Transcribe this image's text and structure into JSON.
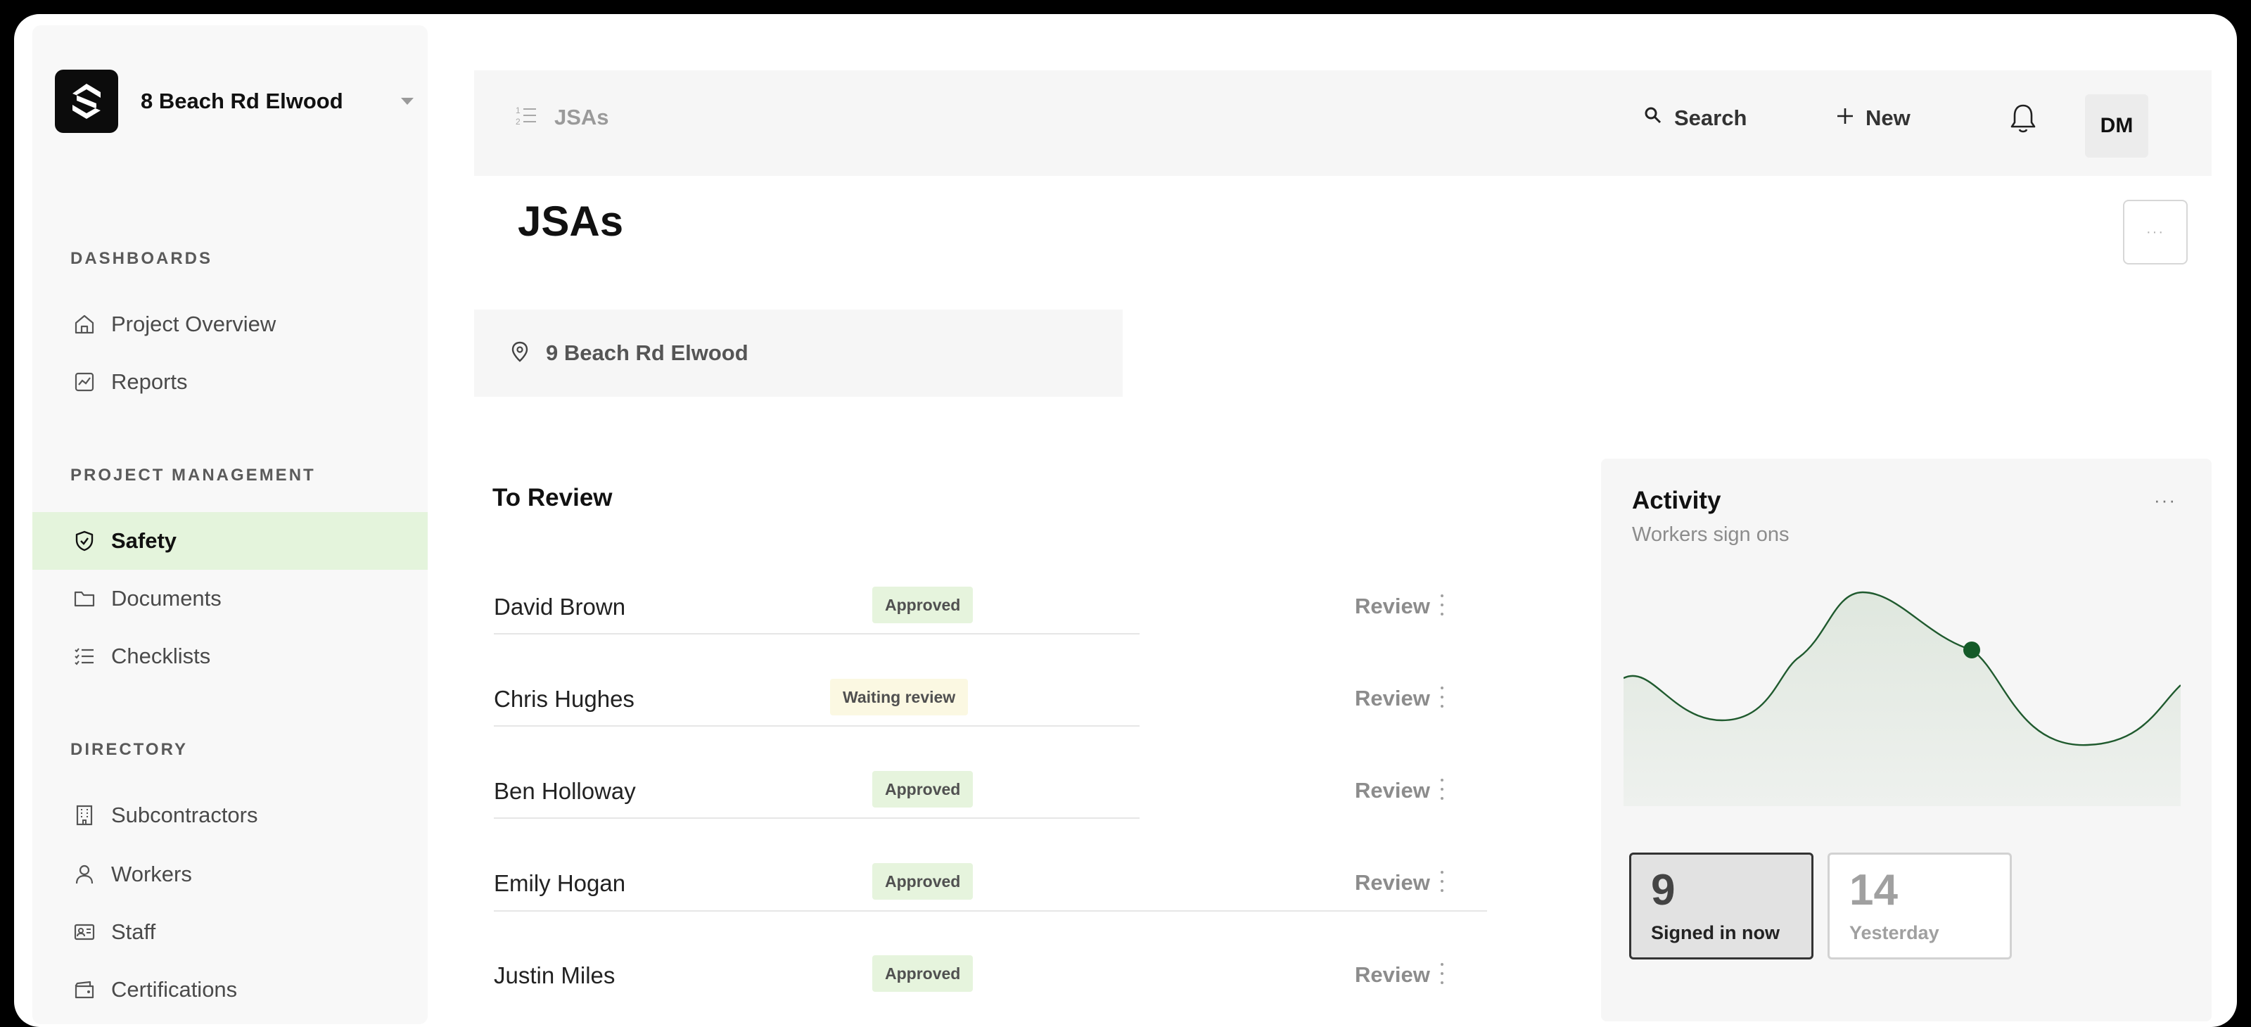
{
  "project": {
    "name": "8 Beach Rd Elwood"
  },
  "sidebar": {
    "sections": [
      {
        "label": "DASHBOARDS",
        "items": [
          {
            "label": "Project Overview",
            "icon": "home-icon"
          },
          {
            "label": "Reports",
            "icon": "chart-icon"
          }
        ]
      },
      {
        "label": "PROJECT MANAGEMENT",
        "items": [
          {
            "label": "Safety",
            "icon": "shield-icon",
            "active": true
          },
          {
            "label": "Documents",
            "icon": "folder-icon"
          },
          {
            "label": "Checklists",
            "icon": "checklist-icon"
          }
        ]
      },
      {
        "label": "DIRECTORY",
        "items": [
          {
            "label": "Subcontractors",
            "icon": "building-icon"
          },
          {
            "label": "Workers",
            "icon": "user-icon"
          },
          {
            "label": "Staff",
            "icon": "id-card-icon"
          },
          {
            "label": "Certifications",
            "icon": "wallet-icon"
          }
        ]
      }
    ]
  },
  "topbar": {
    "breadcrumb": "JSAs",
    "search_label": "Search",
    "new_label": "New",
    "avatar_initials": "DM"
  },
  "page": {
    "title": "JSAs",
    "location": "9 Beach Rd Elwood"
  },
  "review": {
    "title": "To Review",
    "action_label": "Review",
    "rows": [
      {
        "name": "David Brown",
        "status": "Approved"
      },
      {
        "name": "Chris Hughes",
        "status": "Waiting review"
      },
      {
        "name": "Ben Holloway",
        "status": "Approved"
      },
      {
        "name": "Emily Hogan",
        "status": "Approved"
      },
      {
        "name": "Justin Miles",
        "status": "Approved"
      }
    ]
  },
  "activity": {
    "title": "Activity",
    "subtitle": "Workers sign ons",
    "stats": [
      {
        "value": "9",
        "label": "Signed in now"
      },
      {
        "value": "14",
        "label": "Yesterday"
      }
    ]
  },
  "colors": {
    "active_nav": "#e4f4dc",
    "approved_badge": "#e6f4dd",
    "waiting_badge": "#fbf8e2",
    "chart_line": "#1f5a2e",
    "chart_marker": "#145a28"
  }
}
